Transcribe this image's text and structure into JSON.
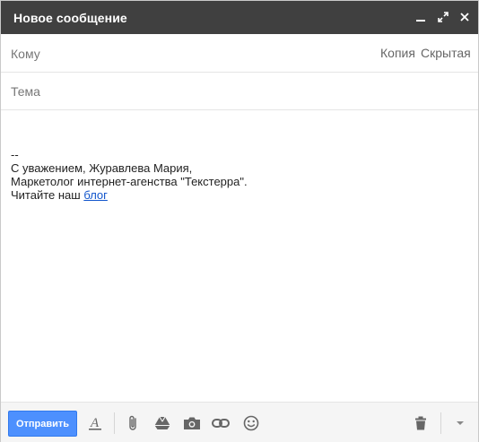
{
  "window": {
    "title": "Новое сообщение"
  },
  "fields": {
    "to_label": "Кому",
    "cc_label": "Копия",
    "bcc_label": "Скрытая",
    "subject_label": "Тема"
  },
  "body": {
    "lines": [
      "--",
      "С уважением, Журавлева Мария,",
      "Маркетолог интернет-агенства \"Текстерра\"."
    ],
    "last_line_prefix": "Читайте наш ",
    "link_text": "блог"
  },
  "toolbar": {
    "send_label": "Отправить",
    "icons": [
      "format-text-icon",
      "attach-icon",
      "drive-icon",
      "photo-icon",
      "link-icon",
      "emoji-icon",
      "trash-icon",
      "more-options-icon"
    ]
  },
  "colors": {
    "titlebar": "#404040",
    "send_button": "#4d90fe",
    "link": "#1155cc"
  }
}
